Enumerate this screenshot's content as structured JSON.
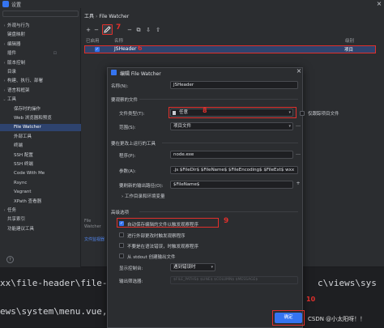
{
  "window": {
    "title": "设置"
  },
  "sidebar": {
    "items": [
      {
        "label": "外观与行为",
        "arrow": "›"
      },
      {
        "label": "键盘映射",
        "arrow": ""
      },
      {
        "label": "编辑器",
        "arrow": "›"
      },
      {
        "label": "插件",
        "arrow": "",
        "count": "⊡"
      },
      {
        "label": "版本控制",
        "arrow": "›"
      },
      {
        "label": "目录",
        "arrow": ""
      },
      {
        "label": "构建、执行、部署",
        "arrow": "›"
      },
      {
        "label": "语言和框架",
        "arrow": "›"
      },
      {
        "label": "工具",
        "arrow": "⌄"
      },
      {
        "label": "保存时的操作",
        "arrow": ""
      },
      {
        "label": "Web 浏览器和预览",
        "arrow": ""
      },
      {
        "label": "File Watcher",
        "arrow": ""
      },
      {
        "label": "外部工具",
        "arrow": ""
      },
      {
        "label": "终端",
        "arrow": ""
      },
      {
        "label": "SSH 配置",
        "arrow": ""
      },
      {
        "label": "SSH 终端",
        "arrow": ""
      },
      {
        "label": "Code With Me",
        "arrow": ""
      },
      {
        "label": "Rsync",
        "arrow": ""
      },
      {
        "label": "Vagrant",
        "arrow": ""
      },
      {
        "label": "XPath 查看器",
        "arrow": ""
      },
      {
        "label": "任务",
        "arrow": "›"
      },
      {
        "label": "共享索引",
        "arrow": ""
      },
      {
        "label": "功能建议工具",
        "arrow": ""
      }
    ]
  },
  "breadcrumb": {
    "root": "工具",
    "sep": "›",
    "current": "File Watcher"
  },
  "toolbar": {
    "add": "+",
    "remove": "−",
    "copy": "⧉",
    "import": "⇩",
    "export": "⇧"
  },
  "annotations": {
    "a7": "7",
    "a8": "8",
    "a9": "9",
    "a10": "10"
  },
  "table": {
    "col_enabled": "已启用",
    "col_name": "名称",
    "col_level": "级别",
    "rows": [
      {
        "checked": "✓",
        "name": "JSHeader",
        "level": "项目"
      }
    ]
  },
  "footer": {
    "note": "File Watcher",
    "link": "文件监视器"
  },
  "dialog": {
    "title": "编辑 File Watcher",
    "name_label": "名称(N):",
    "name_value": "JSHeader",
    "files_section": "要观察的文件",
    "filetype_label": "文件类型(T):",
    "filetype_value": "任意",
    "track_label": "仅跟踪项目文件",
    "scope_label": "范围(S):",
    "scope_value": "项目文件",
    "tool_section": "要在更改上运行的工具",
    "program_label": "程序(P):",
    "program_value": "node.exe",
    "args_label": "参数(A):",
    "args_value": ".js $FileDir$ $FileName$ $FileEncoding$ $FileExt$ wxx",
    "refresh_label": "要刷新的输出路径(O):",
    "refresh_value": "$FileName$",
    "workdir_label": "工作目录和环境变量",
    "advanced_section": "高级选项",
    "opt1": "自动保存编辑的文件以触发观察程序",
    "opt2": "进行外部更改时触发观察程序",
    "opt3": "不要是在语法错误，时触发观察程序",
    "opt4": "从 stdout 创建输出文件",
    "console_label": "显示控制台:",
    "console_value": "遇到错误时",
    "filters_label": "输出筛选器:",
    "filters_value": "$FILE_PATHS$  $LINE$  $COLUMN$  $MESSAGE$",
    "ok": "确定"
  },
  "terminal": {
    "line1": "xx\\file-header\\file-he",
    "line1b": "c\\views\\sys",
    "line2": "ews\\system\\menu.vue, e"
  },
  "watermark": "CSDN @小太阳呀！！",
  "help": "?"
}
